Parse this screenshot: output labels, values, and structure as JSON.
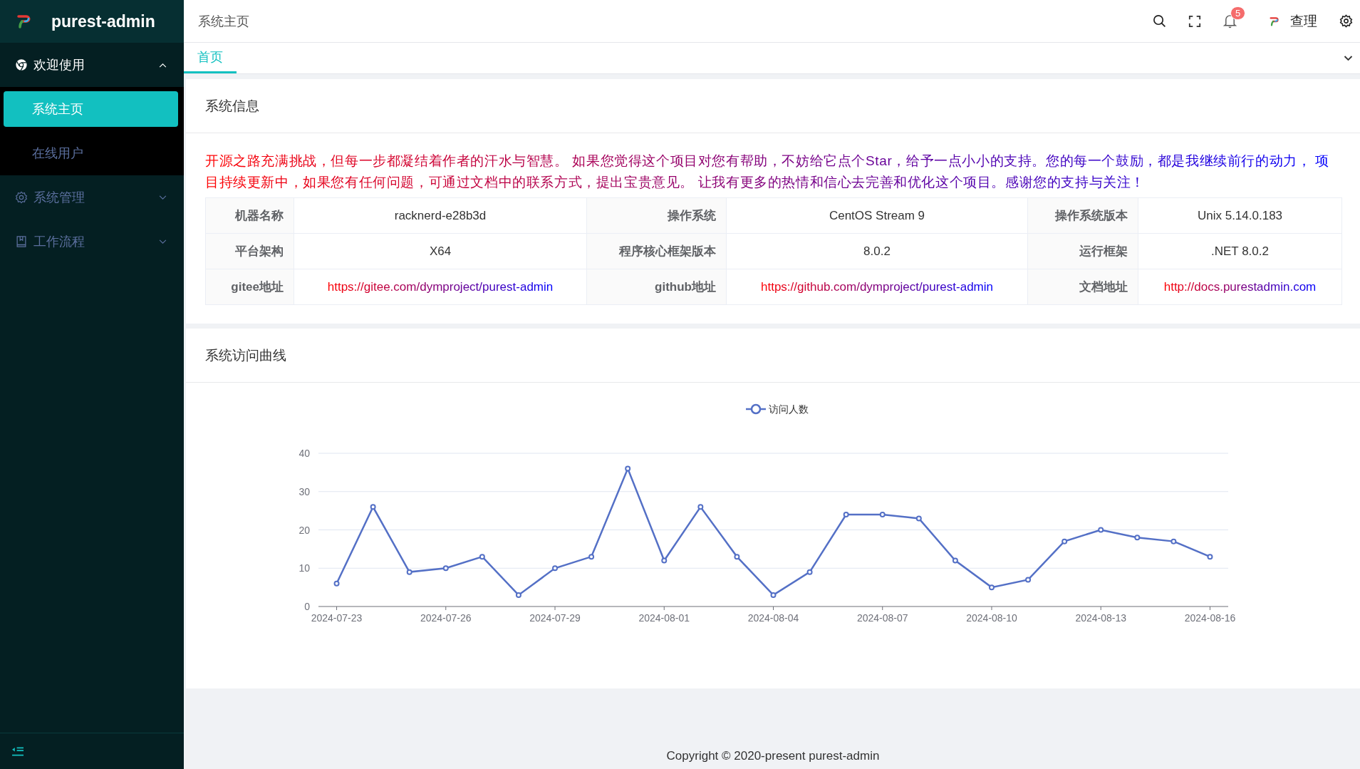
{
  "sidebar": {
    "title": "purest-admin",
    "menu": [
      {
        "label": "欢迎使用",
        "kind": "chrome",
        "expanded": true,
        "children": [
          {
            "label": "系统主页",
            "selected": true
          },
          {
            "label": "在线用户",
            "selected": false
          }
        ]
      },
      {
        "label": "系统管理",
        "kind": "gear",
        "expanded": false
      },
      {
        "label": "工作流程",
        "kind": "book",
        "expanded": false
      }
    ]
  },
  "header": {
    "breadcrumb": "系统主页",
    "notification_count": "5",
    "username": "查理"
  },
  "tabs": [
    {
      "label": "首页",
      "selected": true
    }
  ],
  "info_card": {
    "title": "系统信息",
    "message": "开源之路充满挑战，但每一步都凝结着作者的汗水与智慧。 如果您觉得这个项目对您有帮助，不妨给它点个Star，给予一点小小的支持。您的每一个鼓励，都是我继续前行的动力， 项目持续更新中，如果您有任何问题，可通过文档中的联系方式，提出宝贵意见。 让我有更多的热情和信心去完善和优化这个项目。感谢您的支持与关注！",
    "rows": [
      [
        {
          "label": "机器名称",
          "value": "racknerd-e28b3d",
          "kind": "text"
        },
        {
          "label": "操作系统",
          "value": "CentOS Stream 9",
          "kind": "text"
        },
        {
          "label": "操作系统版本",
          "value": "Unix 5.14.0.183",
          "kind": "text"
        }
      ],
      [
        {
          "label": "平台架构",
          "value": "X64",
          "kind": "text"
        },
        {
          "label": "程序核心框架版本",
          "value": "8.0.2",
          "kind": "text"
        },
        {
          "label": "运行框架",
          "value": ".NET 8.0.2",
          "kind": "text"
        }
      ],
      [
        {
          "label": "gitee地址",
          "value": "https://gitee.com/dymproject/purest-admin",
          "kind": "link"
        },
        {
          "label": "github地址",
          "value": "https://github.com/dymproject/purest-admin",
          "kind": "link"
        },
        {
          "label": "文档地址",
          "value": "http://docs.purestadmin.com",
          "kind": "link"
        }
      ]
    ]
  },
  "chart_card": {
    "title": "系统访问曲线",
    "chart_data": {
      "type": "line",
      "categories": [
        "2024-07-23",
        null,
        null,
        "2024-07-26",
        null,
        null,
        "2024-07-29",
        null,
        null,
        "2024-08-01",
        null,
        null,
        "2024-08-04",
        null,
        null,
        "2024-08-07",
        null,
        null,
        "2024-08-10",
        null,
        null,
        "2024-08-13",
        null,
        null,
        "2024-08-16"
      ],
      "series": [
        {
          "name": "访问人数",
          "color": "#5470c6",
          "marker": true,
          "values": [
            6,
            26,
            9,
            10,
            13,
            3,
            10,
            13,
            36,
            12,
            26,
            13,
            3,
            9,
            24,
            24,
            23,
            12,
            5,
            7,
            17,
            20,
            18,
            17,
            13
          ]
        }
      ],
      "grid": true,
      "ylim": [
        0,
        40
      ],
      "yticks": [
        0,
        10,
        20,
        30,
        40
      ]
    }
  },
  "footer": "Copyright © 2020-present purest-admin"
}
